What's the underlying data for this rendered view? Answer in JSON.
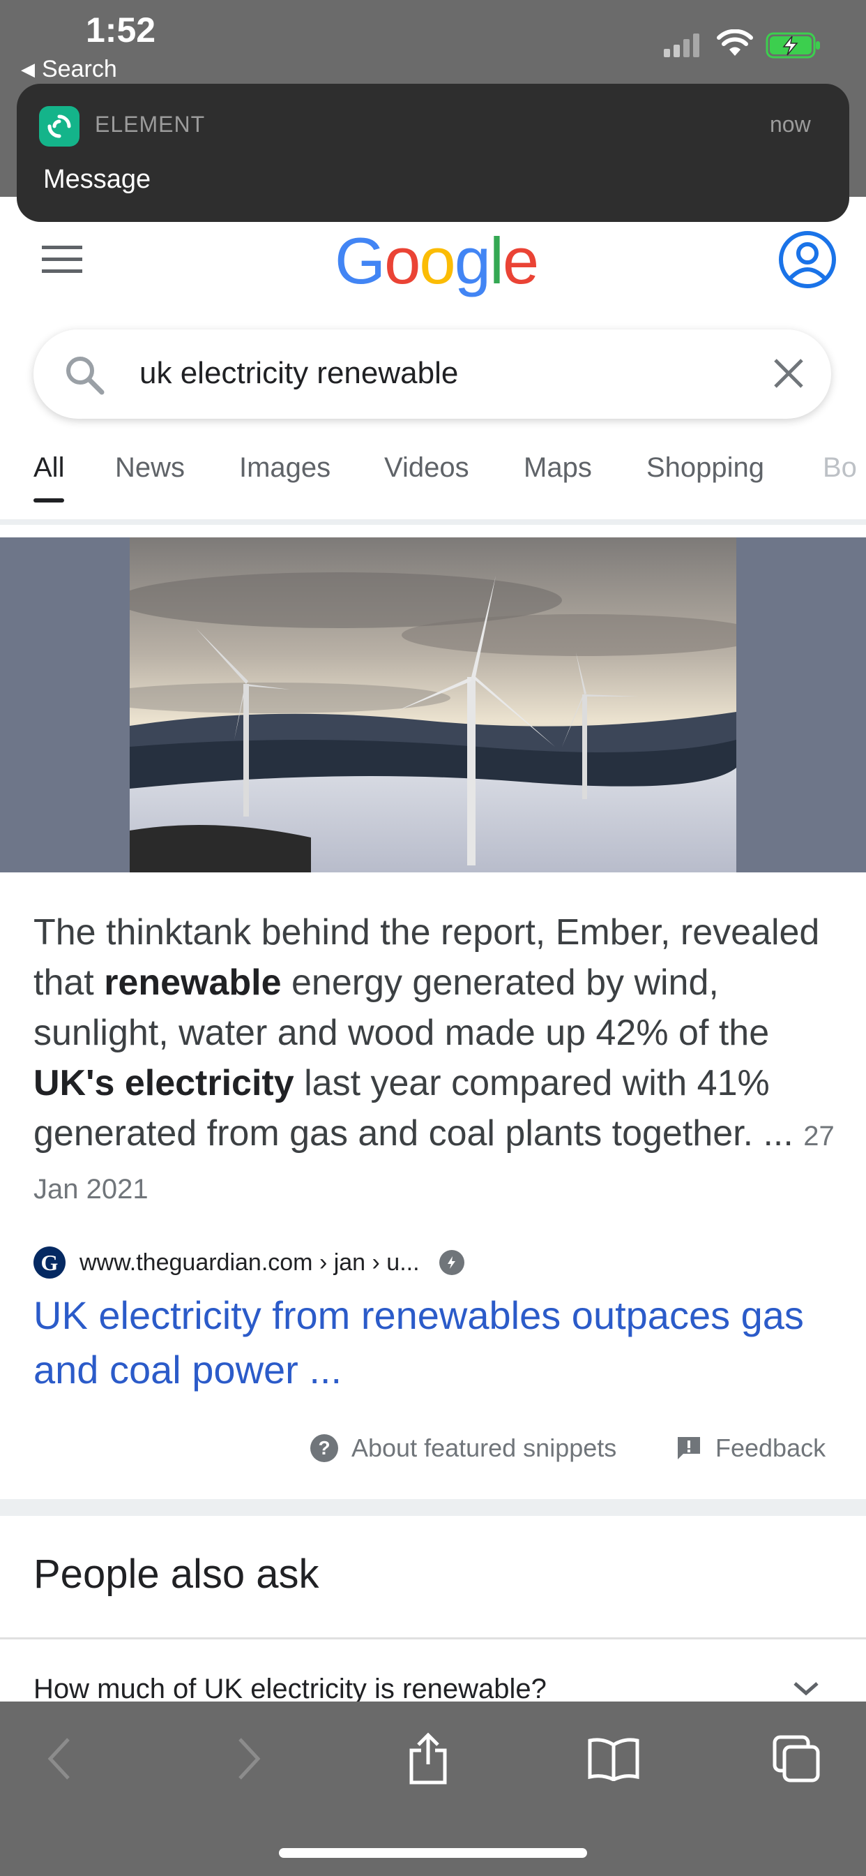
{
  "status_bar": {
    "time": "1:52",
    "back_label": "Search"
  },
  "notification": {
    "app_name": "ELEMENT",
    "time": "now",
    "message": "Message"
  },
  "header": {
    "logo_letters": [
      "G",
      "o",
      "o",
      "g",
      "l",
      "e"
    ],
    "logo_colors": [
      "#4285F4",
      "#EA4335",
      "#FBBC05",
      "#4285F4",
      "#34A853",
      "#EA4335"
    ]
  },
  "search": {
    "query": "uk electricity renewable"
  },
  "tabs": [
    {
      "label": "All",
      "active": true
    },
    {
      "label": "News"
    },
    {
      "label": "Images"
    },
    {
      "label": "Videos"
    },
    {
      "label": "Maps"
    },
    {
      "label": "Shopping"
    },
    {
      "label": "Bo"
    }
  ],
  "featured_snippet": {
    "text_parts": [
      {
        "text": "The thinktank behind the report, Ember, revealed that "
      },
      {
        "text": "renewable",
        "bold": true
      },
      {
        "text": " energy generated by wind, sunlight, water and wood made up 42% of the "
      },
      {
        "text": "UK's electricity",
        "bold": true
      },
      {
        "text": " last year compared with 41% generated from gas and coal plants together. ... "
      }
    ],
    "date": "27 Jan 2021",
    "source_url": "www.theguardian.com › jan › u...",
    "link_title": "UK electricity from renewables outpaces gas and coal power ...",
    "about_label": "About featured snippets",
    "feedback_label": "Feedback"
  },
  "people_also_ask": {
    "title": "People also ask",
    "questions": [
      "How much of UK electricity is renewable?"
    ]
  },
  "colors": {
    "link": "#2b5bc9",
    "element_green": "#14b48a",
    "toolbar": "#6a6a6a"
  }
}
